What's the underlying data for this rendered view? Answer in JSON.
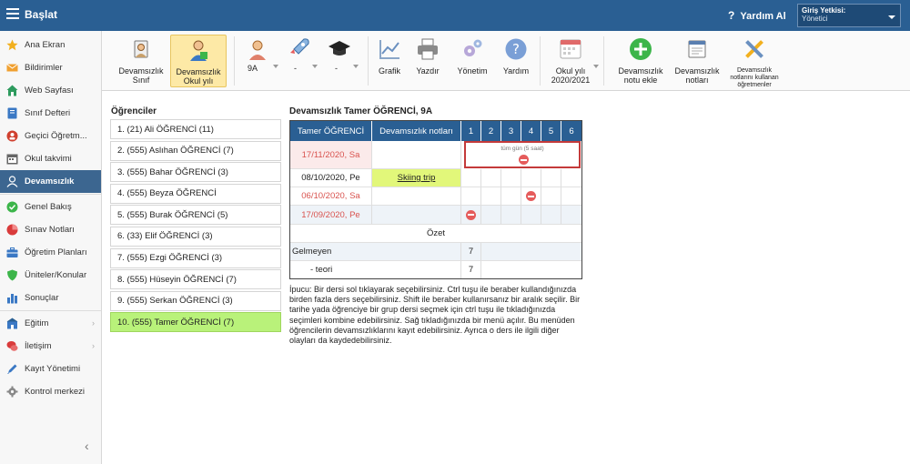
{
  "topbar": {
    "title": "Başlat",
    "help_label": "Yardım Al",
    "role_label": "Giriş Yetkisi:",
    "role_value": "Yönetici"
  },
  "sidebar": {
    "items": [
      {
        "label": "Ana Ekran",
        "icon": "star-icon",
        "color": "#f2b01e"
      },
      {
        "label": "Bildirimler",
        "icon": "envelope-icon",
        "color": "#f0a030"
      },
      {
        "label": "Web Sayfası",
        "icon": "home-icon",
        "color": "#2e9b5e"
      },
      {
        "label": "Sınıf Defteri",
        "icon": "notebook-icon",
        "color": "#3a78c4"
      },
      {
        "label": "Geçici Öğretm...",
        "icon": "substitute-teacher-icon",
        "color": "#d0402f"
      },
      {
        "label": "Okul takvimi",
        "icon": "calendar-icon",
        "color": "#666666"
      },
      {
        "label": "Devamsızlık",
        "icon": "person-icon",
        "color": "#ffffff"
      },
      {
        "label": "Genel Bakış",
        "icon": "check-circle-icon",
        "color": "#3cb54a"
      },
      {
        "label": "Sınav Notları",
        "icon": "chart-pie-icon",
        "color": "#d93b3b"
      },
      {
        "label": "Öğretim Planları",
        "icon": "briefcase-icon",
        "color": "#3a78c4"
      },
      {
        "label": "Üniteler/Konular",
        "icon": "shield-icon",
        "color": "#3cb54a"
      },
      {
        "label": "Sonuçlar",
        "icon": "bar-chart-icon",
        "color": "#3a78c4"
      },
      {
        "label": "Eğitim",
        "icon": "school-icon",
        "color": "#3a78c4"
      },
      {
        "label": "İletişim",
        "icon": "chat-icon",
        "color": "#d93b3b"
      },
      {
        "label": "Kayıt Yönetimi",
        "icon": "pencil-icon",
        "color": "#3a78c4"
      },
      {
        "label": "Kontrol merkezi",
        "icon": "gear-icon",
        "color": "#888888"
      }
    ]
  },
  "toolbar": {
    "btn_sinif": "Devamsızlık Sınıf",
    "btn_okul": "Devamsızlık Okul yılı",
    "dd_class": "9A",
    "dd_2": "-",
    "dd_3": "-",
    "btn_grafik": "Grafik",
    "btn_yazdir": "Yazdır",
    "btn_yonetim": "Yönetim",
    "btn_yardim": "Yardım",
    "btn_year": "Okul yılı 2020/2021",
    "btn_add": "Devamsızlık notu ekle",
    "btn_notes": "Devamsızlık notları",
    "btn_teachers": "Devamsızlık notlarını kullanan öğretmenler"
  },
  "students": {
    "title": "Öğrenciler",
    "rows": [
      "1.   (21)    Ali ÖĞRENCİ (11)",
      "2.   (555)  Aslıhan ÖĞRENCİ (7)",
      "3.   (555)  Bahar ÖĞRENCİ (3)",
      "4.   (555)  Beyza ÖĞRENCİ",
      "5.   (555)  Burak ÖĞRENCİ (5)",
      "6.   (33)    Elif ÖĞRENCİ (3)",
      "7.   (555)  Ezgi ÖĞRENCİ (3)",
      "8.   (555)  Hüseyin ÖĞRENCİ (7)",
      "9.   (555)  Serkan ÖĞRENCİ (3)",
      "10. (555)  Tamer ÖĞRENCİ (7)"
    ],
    "selected_index": 9
  },
  "attendance": {
    "title": "Devamsızlık Tamer ÖĞRENCİ, 9A",
    "headers": {
      "name": "Tamer ÖĞRENCİ",
      "notes": "Devamsızlık notları",
      "periods": [
        "1",
        "2",
        "3",
        "4",
        "5",
        "6"
      ]
    },
    "rows": [
      {
        "date": "17/11/2020, Sa",
        "red": true,
        "note": ""
      },
      {
        "date": "08/10/2020, Pe",
        "red": false,
        "note": "Skiing trip"
      },
      {
        "date": "06/10/2020, Sa",
        "red": true,
        "note": ""
      },
      {
        "date": "17/09/2020, Pe",
        "red": true,
        "note": ""
      }
    ],
    "highlight_text": "tüm gün (5 saat)",
    "summary": "Özet",
    "summary_rows": [
      {
        "label": "Gelmeyen",
        "value": "7"
      },
      {
        "label": "- teori",
        "value": "7"
      }
    ]
  },
  "hint": "İpucu: Bir dersi sol tıklayarak seçebilirsiniz. Ctrl tuşu ile beraber kullandığınızda birden fazla ders seçebilirsiniz. Shift ile beraber kullanırsanız bir aralık seçilir. Bir tarihe yada öğrenciye bir grup dersi seçmek için ctrl tuşu ile tıkladığınızda seçimleri kombine edebilirsiniz. Sağ tıkladığınızda bir menü açılır. Bu menüden öğrencilerin devamsızlıklarını kayıt edebilirsiniz. Ayrıca o ders ile ilgili diğer olayları da kaydedebilirsiniz."
}
